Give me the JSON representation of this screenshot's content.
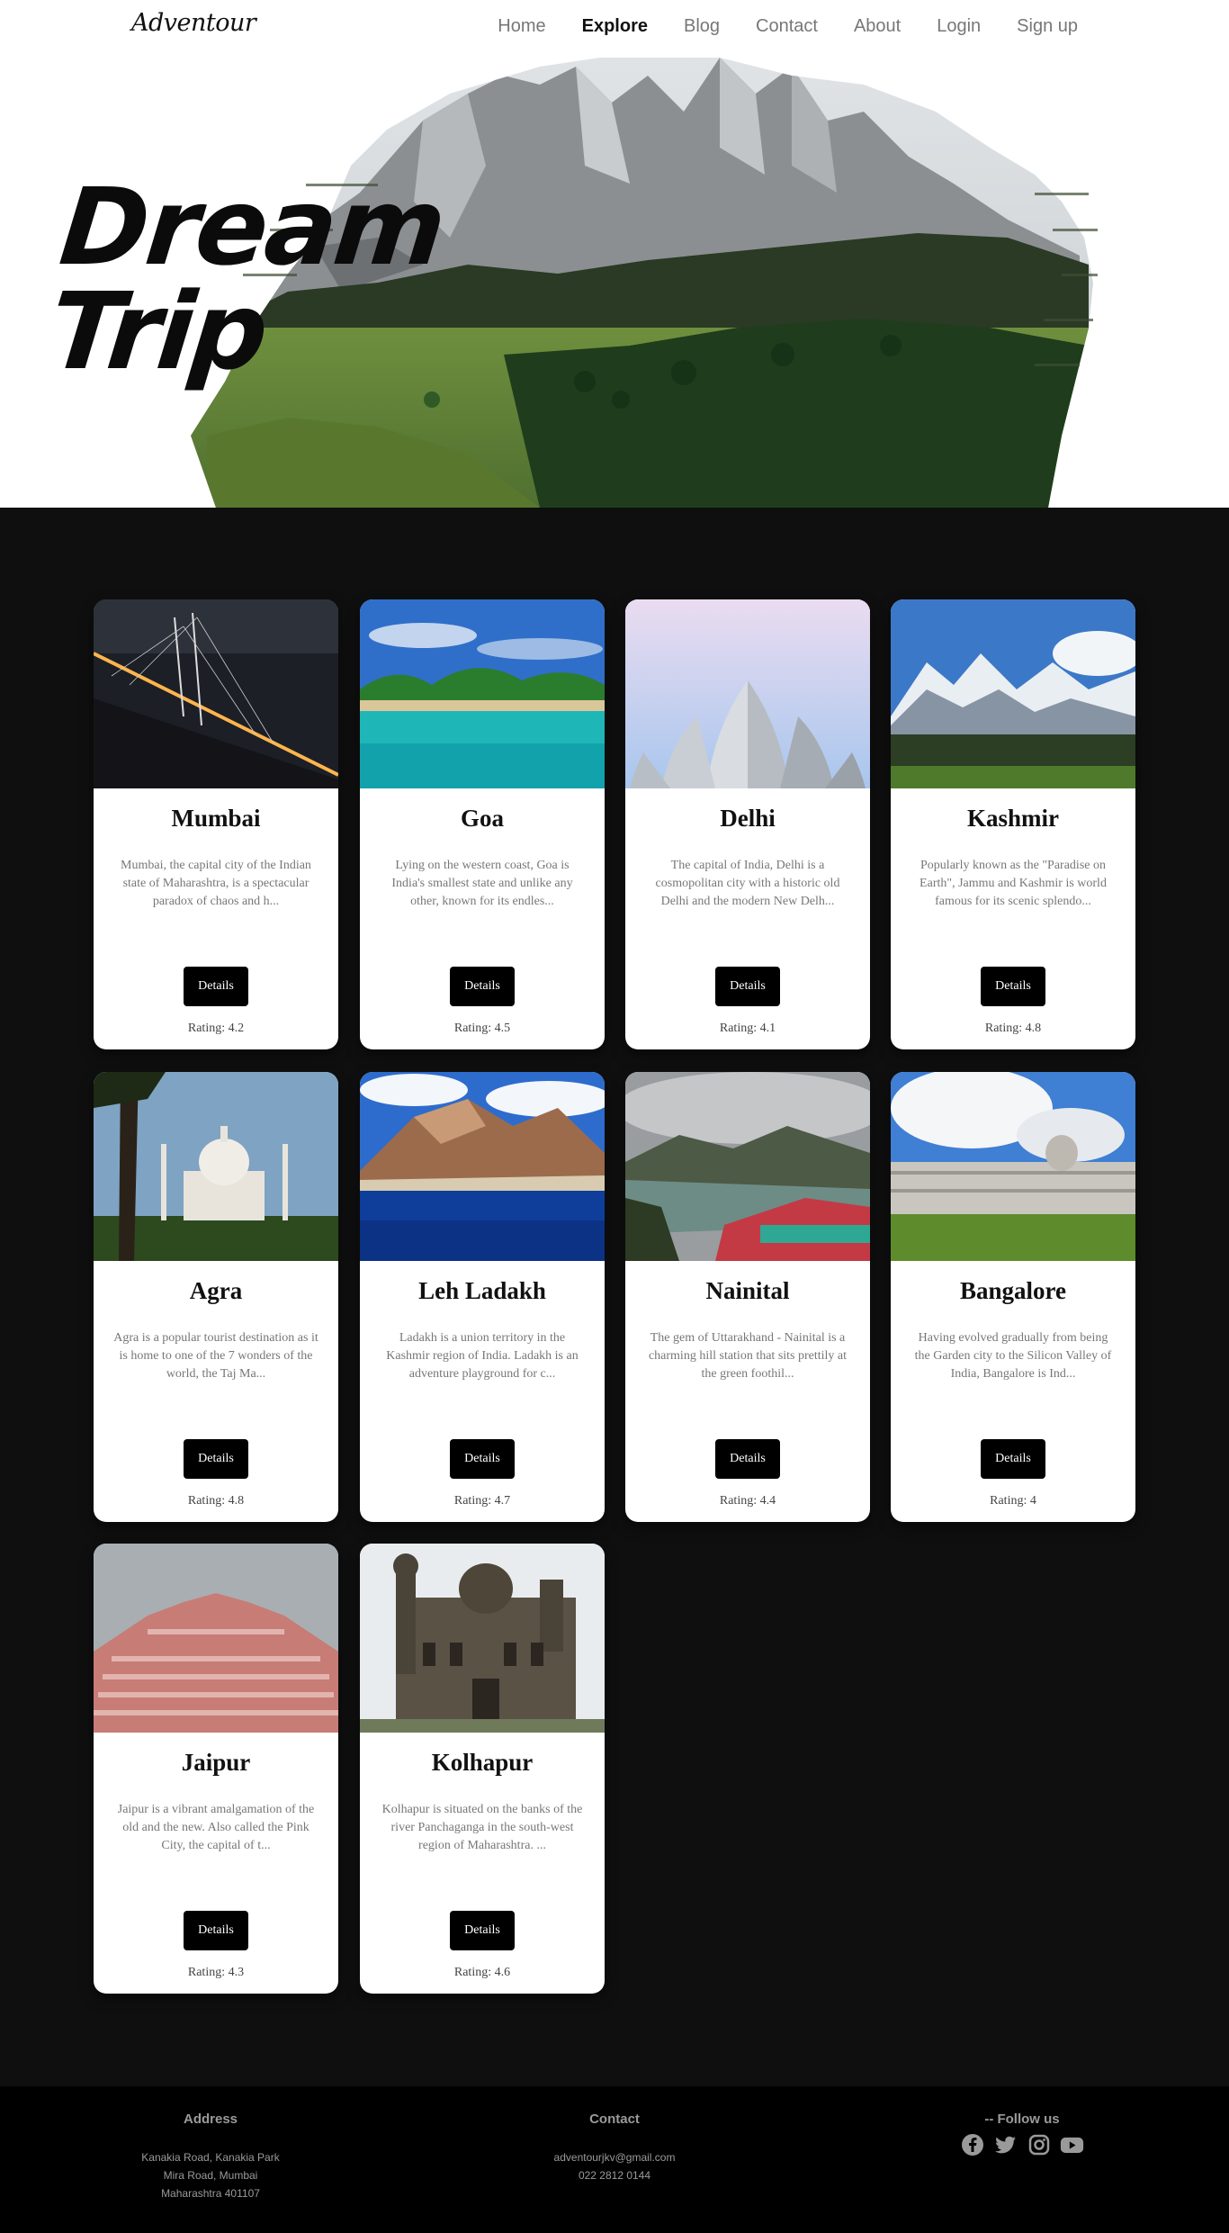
{
  "brand": {
    "logo": "Adventour"
  },
  "nav": {
    "links": [
      {
        "label": "Home",
        "active": false
      },
      {
        "label": "Explore",
        "active": true
      },
      {
        "label": "Blog",
        "active": false
      },
      {
        "label": "Contact",
        "active": false
      },
      {
        "label": "About",
        "active": false
      },
      {
        "label": "Login",
        "active": false
      },
      {
        "label": "Sign up",
        "active": false
      }
    ]
  },
  "hero": {
    "title_line1": "Dream",
    "title_line2": "Trip"
  },
  "cards": [
    {
      "title": "Mumbai",
      "desc": "Mumbai, the capital city of the Indian state of Maharashtra, is a spectacular paradox of chaos and h...",
      "button": "Details",
      "rating": "Rating: 4.2"
    },
    {
      "title": "Goa",
      "desc": "Lying on the western coast, Goa is India's smallest state and unlike any other, known for its endles...",
      "button": "Details",
      "rating": "Rating: 4.5"
    },
    {
      "title": "Delhi",
      "desc": "The capital of India, Delhi is a cosmopolitan city with a historic old Delhi and the modern New Delh...",
      "button": "Details",
      "rating": "Rating: 4.1"
    },
    {
      "title": "Kashmir",
      "desc": "Popularly known as the \"Paradise on Earth\", Jammu and Kashmir is world famous for its scenic splendo...",
      "button": "Details",
      "rating": "Rating: 4.8"
    },
    {
      "title": "Agra",
      "desc": "Agra is a popular tourist destination as it is home to one of the 7 wonders of the world, the Taj Ma...",
      "button": "Details",
      "rating": "Rating: 4.8"
    },
    {
      "title": "Leh Ladakh",
      "desc": "Ladakh is a union territory in the Kashmir region of India. Ladakh is an adventure playground for c...",
      "button": "Details",
      "rating": "Rating: 4.7"
    },
    {
      "title": "Nainital",
      "desc": "The gem of Uttarakhand - Nainital is a charming hill station that sits prettily at the green foothil...",
      "button": "Details",
      "rating": "Rating: 4.4"
    },
    {
      "title": "Bangalore",
      "desc": "Having evolved gradually from being the Garden city to the Silicon Valley of India, Bangalore is Ind...",
      "button": "Details",
      "rating": "Rating: 4"
    },
    {
      "title": "Jaipur",
      "desc": "Jaipur is a vibrant amalgamation of the old and the new. Also called the Pink City, the capital of t...",
      "button": "Details",
      "rating": "Rating: 4.3"
    },
    {
      "title": "Kolhapur",
      "desc": "Kolhapur is situated on the banks of the river Panchaganga in the south-west region of Maharashtra. ...",
      "button": "Details",
      "rating": "Rating: 4.6"
    }
  ],
  "footer": {
    "address": {
      "heading": "Address",
      "lines": [
        "Kanakia Road, Kanakia Park",
        "Mira Road, Mumbai",
        "Maharashtra 401107"
      ]
    },
    "contact": {
      "heading": "Contact",
      "lines": [
        "adventourjkv@gmail.com",
        "022 2812 0144"
      ]
    },
    "follow": {
      "heading": "-- Follow us",
      "icons": [
        "facebook-icon",
        "twitter-icon",
        "instagram-icon",
        "youtube-icon"
      ]
    }
  },
  "colors": {
    "section_bg": "#0f0f0f",
    "footer_bg": "#000000",
    "button_bg": "#000000",
    "nav_active": "#111111",
    "nav_inactive": "#777777"
  }
}
